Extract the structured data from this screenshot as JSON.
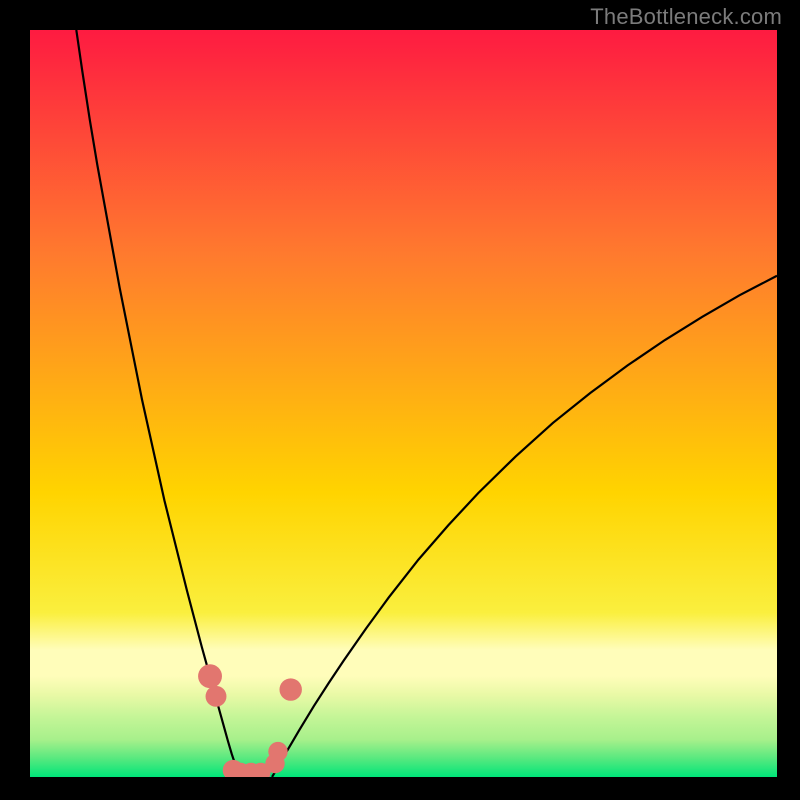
{
  "watermark": "TheBottleneck.com",
  "colors": {
    "top": "#fe1b41",
    "mid": "#ffd400",
    "band_light": "#fffdba",
    "band_green1": "#e9f9a6",
    "band_green2": "#a7f08b",
    "bottom": "#00e579",
    "frame": "#000000",
    "curve": "#000000",
    "marker_fill": "#e2766f",
    "marker_stroke": "#b84f48"
  },
  "chart_data": {
    "type": "line",
    "title": "",
    "xlabel": "",
    "ylabel": "",
    "xlim": [
      0,
      100
    ],
    "ylim": [
      0,
      100
    ],
    "grid": false,
    "legend": false,
    "series": [
      {
        "name": "left-curve",
        "x": [
          6.2,
          7,
          8,
          9,
          10,
          11,
          12,
          13,
          14,
          15,
          16,
          17,
          18,
          19,
          20,
          21,
          22,
          23,
          23.5,
          24,
          24.5,
          25,
          25.5,
          26,
          26.5,
          27,
          27.5,
          28,
          28.3
        ],
        "y": [
          100,
          94.5,
          88,
          82,
          76.5,
          71,
          65.5,
          60.5,
          55.5,
          50.5,
          46,
          41.5,
          37,
          33,
          29,
          25,
          21.2,
          17.4,
          15.6,
          13.8,
          12,
          10.2,
          8.4,
          6.6,
          4.8,
          3.1,
          1.6,
          0.5,
          0
        ]
      },
      {
        "name": "right-curve",
        "x": [
          32.4,
          33,
          34,
          35,
          36,
          38,
          40,
          42,
          45,
          48,
          52,
          56,
          60,
          65,
          70,
          75,
          80,
          85,
          90,
          95,
          100
        ],
        "y": [
          0,
          1.0,
          2.8,
          4.5,
          6.2,
          9.5,
          12.6,
          15.6,
          19.9,
          24.0,
          29.1,
          33.7,
          38.0,
          42.9,
          47.4,
          51.4,
          55.1,
          58.5,
          61.6,
          64.5,
          67.1
        ]
      }
    ],
    "markers": [
      {
        "x": 24.1,
        "y": 13.5,
        "r": 1.6
      },
      {
        "x": 24.9,
        "y": 10.8,
        "r": 1.4
      },
      {
        "x": 27.2,
        "y": 0.9,
        "r": 1.4
      },
      {
        "x": 28.2,
        "y": 0.6,
        "r": 1.3
      },
      {
        "x": 29.6,
        "y": 0.6,
        "r": 1.3
      },
      {
        "x": 30.9,
        "y": 0.6,
        "r": 1.3
      },
      {
        "x": 32.8,
        "y": 1.8,
        "r": 1.3
      },
      {
        "x": 33.2,
        "y": 3.4,
        "r": 1.3
      },
      {
        "x": 34.9,
        "y": 11.7,
        "r": 1.5
      }
    ]
  }
}
